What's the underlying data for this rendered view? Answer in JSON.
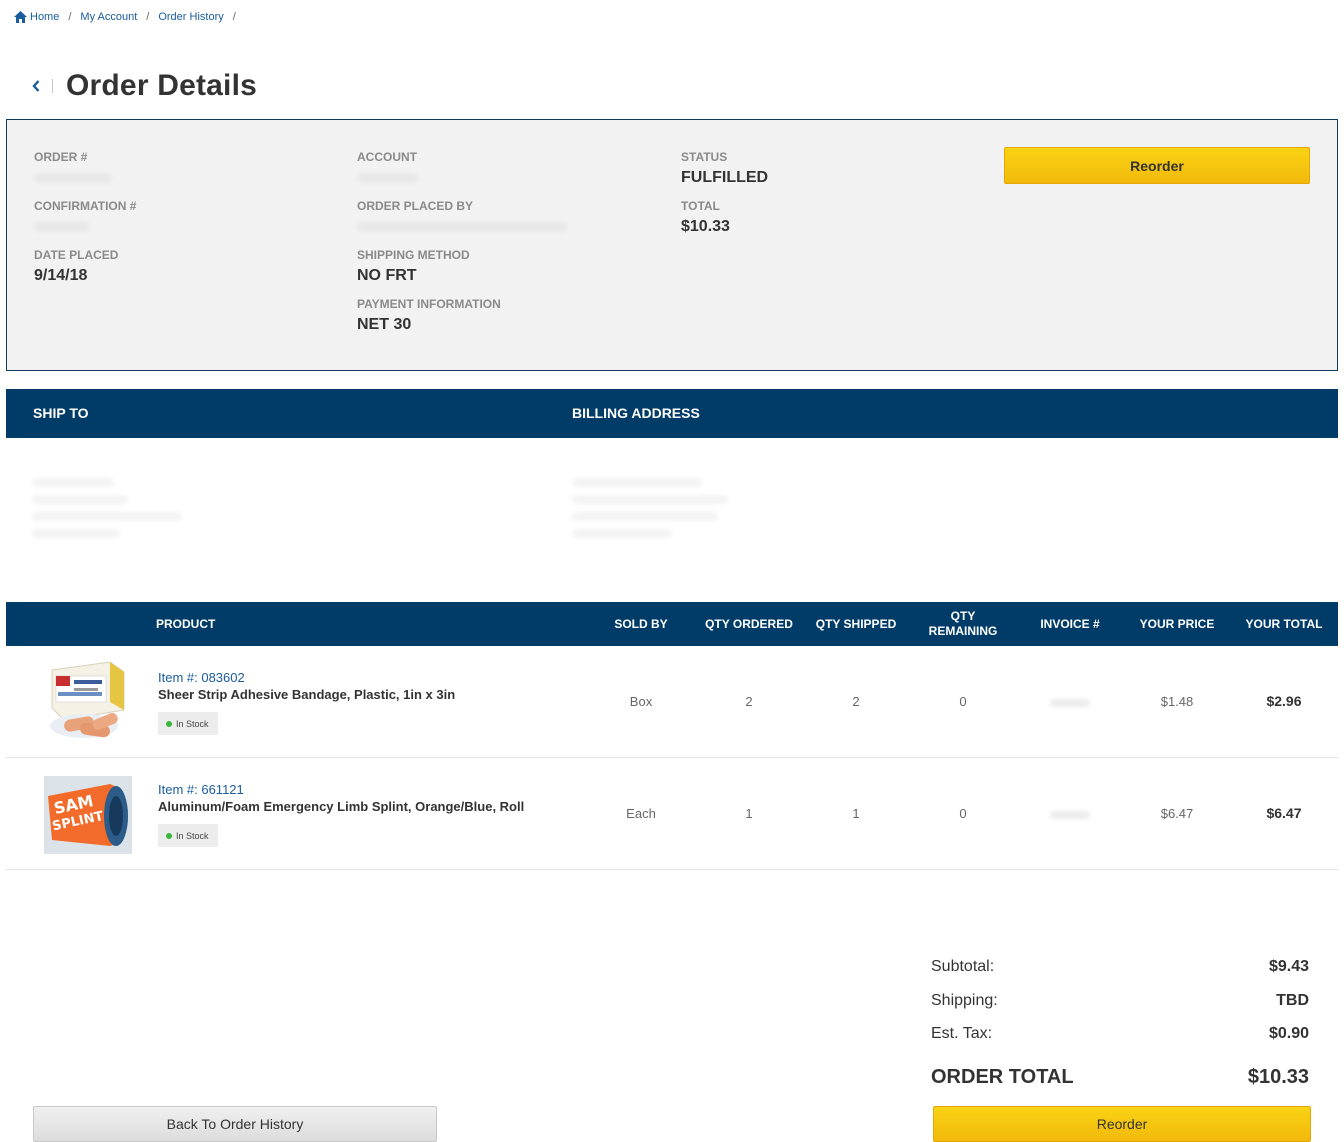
{
  "breadcrumb": {
    "home": "Home",
    "account": "My Account",
    "history": "Order History",
    "sep": "/"
  },
  "page": {
    "title": "Order Details"
  },
  "summary": {
    "order_label": "ORDER #",
    "confirmation_label": "CONFIRMATION #",
    "date_label": "DATE PLACED",
    "date_value": "9/14/18",
    "account_label": "ACCOUNT",
    "placed_by_label": "ORDER PLACED BY",
    "shipping_label": "SHIPPING METHOD",
    "shipping_value": "NO FRT",
    "payment_label": "PAYMENT INFORMATION",
    "payment_value": "NET 30",
    "status_label": "STATUS",
    "status_value": "FULFILLED",
    "total_label": "TOTAL",
    "total_value": "$10.33",
    "reorder_label": "Reorder"
  },
  "addresses": {
    "ship_to": "SHIP TO",
    "billing": "BILLING ADDRESS"
  },
  "table": {
    "headers": {
      "product": "PRODUCT",
      "sold_by": "SOLD BY",
      "qty_ordered": "QTY ORDERED",
      "qty_shipped": "QTY SHIPPED",
      "qty_remaining_1": "QTY",
      "qty_remaining_2": "REMAINING",
      "invoice": "INVOICE #",
      "your_price": "YOUR PRICE",
      "your_total": "YOUR TOTAL"
    },
    "rows": [
      {
        "item_num": "Item #: 083602",
        "name": "Sheer Strip Adhesive Bandage, Plastic, 1in x 3in",
        "stock": "In Stock",
        "sold_by": "Box",
        "qty_ordered": "2",
        "qty_shipped": "2",
        "qty_remaining": "0",
        "price": "$1.48",
        "total": "$2.96"
      },
      {
        "item_num": "Item #: 661121",
        "name": "Aluminum/Foam Emergency Limb Splint, Orange/Blue, Roll",
        "stock": "In Stock",
        "sold_by": "Each",
        "qty_ordered": "1",
        "qty_shipped": "1",
        "qty_remaining": "0",
        "price": "$6.47",
        "total": "$6.47",
        "image_text_1": "SAM",
        "image_text_2": "SPLINT"
      }
    ]
  },
  "totals": {
    "subtotal_label": "Subtotal:",
    "subtotal_value": "$9.43",
    "shipping_label": "Shipping:",
    "shipping_value": "TBD",
    "tax_label": "Est. Tax:",
    "tax_value": "$0.90",
    "order_total_label": "ORDER TOTAL",
    "order_total_value": "$10.33"
  },
  "actions": {
    "back_label": "Back To Order History",
    "reorder_label": "Reorder"
  },
  "colors": {
    "navy": "#003c67",
    "link": "#1a5c9c",
    "accent_yellow": "#f5c60d",
    "in_stock": "#3cb63c",
    "panel_bg": "#f2f2f2"
  }
}
